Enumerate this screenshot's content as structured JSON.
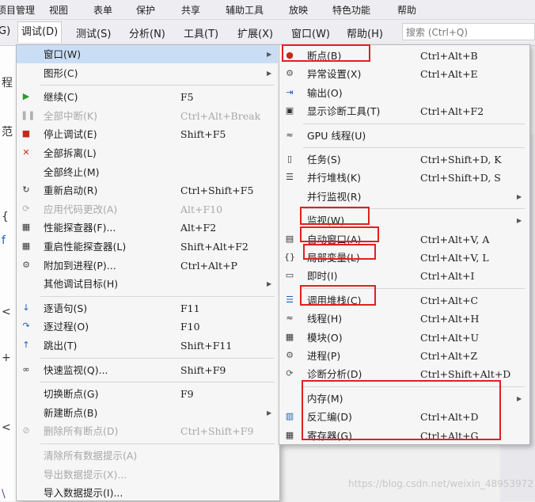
{
  "topbar": [
    "项目管理",
    "视图",
    "表单",
    "保护",
    "共享",
    "辅助工具",
    "放映",
    "特色功能",
    "帮助"
  ],
  "menubar": {
    "left_fragment": "G)",
    "items": [
      "调试(D)",
      "测试(S)",
      "分析(N)",
      "工具(T)",
      "扩展(X)",
      "窗口(W)",
      "帮助(H)"
    ],
    "search_placeholder": "搜索 (Ctrl+Q)"
  },
  "left_gutter": [
    "程",
    "范",
    "{",
    "f",
    "<",
    "+",
    "<",
    "\\"
  ],
  "debug_menu": [
    {
      "label": "窗口(W)",
      "shortcut": "",
      "icon": "",
      "submenu": true,
      "disabled": false,
      "highlighted": true
    },
    {
      "label": "图形(C)",
      "shortcut": "",
      "icon": "",
      "submenu": true,
      "disabled": false
    },
    {
      "sep": true
    },
    {
      "label": "继续(C)",
      "shortcut": "F5",
      "icon": "play-icon",
      "disabled": false
    },
    {
      "label": "全部中断(K)",
      "shortcut": "Ctrl+Alt+Break",
      "icon": "pause-icon",
      "disabled": true
    },
    {
      "label": "停止调试(E)",
      "shortcut": "Shift+F5",
      "icon": "stop-icon",
      "disabled": false
    },
    {
      "label": "全部拆离(L)",
      "shortcut": "",
      "icon": "detach-x-icon",
      "disabled": false
    },
    {
      "label": "全部终止(M)",
      "shortcut": "",
      "icon": "",
      "disabled": false
    },
    {
      "label": "重新启动(R)",
      "shortcut": "Ctrl+Shift+F5",
      "icon": "restart-icon",
      "disabled": false
    },
    {
      "label": "应用代码更改(A)",
      "shortcut": "Alt+F10",
      "icon": "apply-code-icon",
      "disabled": true
    },
    {
      "label": "性能探查器(F)...",
      "shortcut": "Alt+F2",
      "icon": "profiler-icon",
      "disabled": false
    },
    {
      "label": "重启性能探查器(L)",
      "shortcut": "Shift+Alt+F2",
      "icon": "profiler-restart-icon",
      "disabled": false
    },
    {
      "label": "附加到进程(P)...",
      "shortcut": "Ctrl+Alt+P",
      "icon": "attach-icon",
      "disabled": false
    },
    {
      "label": "其他调试目标(H)",
      "shortcut": "",
      "icon": "",
      "submenu": true,
      "disabled": false
    },
    {
      "sep": true
    },
    {
      "label": "逐语句(S)",
      "shortcut": "F11",
      "icon": "step-into-icon",
      "disabled": false
    },
    {
      "label": "逐过程(O)",
      "shortcut": "F10",
      "icon": "step-over-icon",
      "disabled": false
    },
    {
      "label": "跳出(T)",
      "shortcut": "Shift+F11",
      "icon": "step-out-icon",
      "disabled": false
    },
    {
      "sep": true
    },
    {
      "label": "快速监视(Q)...",
      "shortcut": "Shift+F9",
      "icon": "glasses-icon",
      "disabled": false
    },
    {
      "sep": true
    },
    {
      "label": "切换断点(G)",
      "shortcut": "F9",
      "icon": "",
      "disabled": false
    },
    {
      "label": "新建断点(B)",
      "shortcut": "",
      "icon": "",
      "submenu": true,
      "disabled": false
    },
    {
      "label": "删除所有断点(D)",
      "shortcut": "Ctrl+Shift+F9",
      "icon": "delete-breakpoints-icon",
      "disabled": true
    },
    {
      "sep": true
    },
    {
      "label": "清除所有数据提示(A)",
      "shortcut": "",
      "icon": "",
      "disabled": true
    },
    {
      "label": "导出数据提示(X)...",
      "shortcut": "",
      "icon": "",
      "disabled": true
    },
    {
      "label": "导入数据提示(I)...",
      "shortcut": "",
      "icon": "",
      "disabled": false
    }
  ],
  "window_submenu": [
    {
      "label": "断点(B)",
      "shortcut": "Ctrl+Alt+B",
      "icon": "breakpoint-icon"
    },
    {
      "label": "异常设置(X)",
      "shortcut": "Ctrl+Alt+E",
      "icon": "exception-icon"
    },
    {
      "label": "输出(O)",
      "shortcut": "",
      "icon": "output-icon"
    },
    {
      "label": "显示诊断工具(T)",
      "shortcut": "Ctrl+Alt+F2",
      "icon": "diagnostic-icon"
    },
    {
      "sep": true
    },
    {
      "label": "GPU 线程(U)",
      "shortcut": "",
      "icon": "gpu-thread-icon"
    },
    {
      "sep": true
    },
    {
      "label": "任务(S)",
      "shortcut": "Ctrl+Shift+D, K",
      "icon": "task-icon"
    },
    {
      "label": "并行堆栈(K)",
      "shortcut": "Ctrl+Shift+D, S",
      "icon": "parallel-stack-icon"
    },
    {
      "label": "并行监视(R)",
      "shortcut": "",
      "icon": "",
      "submenu": true
    },
    {
      "sep": true
    },
    {
      "label": "监视(W)",
      "shortcut": "",
      "icon": "",
      "submenu": true
    },
    {
      "label": "自动窗口(A)",
      "shortcut": "Ctrl+Alt+V, A",
      "icon": "autos-icon"
    },
    {
      "label": "局部变量(L)",
      "shortcut": "Ctrl+Alt+V, L",
      "icon": "locals-icon"
    },
    {
      "label": "即时(I)",
      "shortcut": "Ctrl+Alt+I",
      "icon": "immediate-icon"
    },
    {
      "sep": true
    },
    {
      "label": "调用堆栈(C)",
      "shortcut": "Ctrl+Alt+C",
      "icon": "call-stack-icon"
    },
    {
      "label": "线程(H)",
      "shortcut": "Ctrl+Alt+H",
      "icon": "threads-icon"
    },
    {
      "label": "模块(O)",
      "shortcut": "Ctrl+Alt+U",
      "icon": "modules-icon"
    },
    {
      "label": "进程(P)",
      "shortcut": "Ctrl+Alt+Z",
      "icon": "process-icon"
    },
    {
      "label": "诊断分析(D)",
      "shortcut": "Ctrl+Shift+Alt+D",
      "icon": "diagnostic-analysis-icon"
    },
    {
      "sep": true
    },
    {
      "label": "内存(M)",
      "shortcut": "",
      "icon": "",
      "submenu": true
    },
    {
      "label": "反汇编(D)",
      "shortcut": "Ctrl+Alt+D",
      "icon": "disassembly-icon"
    },
    {
      "label": "寄存器(G)",
      "shortcut": "Ctrl+Alt+G",
      "icon": "registers-icon"
    }
  ],
  "watermark": "https://blog.csdn.net/weixin_48953972",
  "colors": {
    "highlight_box": "#e02020",
    "play": "#2a9a2a",
    "stop": "#c42b1c",
    "x": "#c42b1c",
    "accent": "#1e5fb4"
  }
}
